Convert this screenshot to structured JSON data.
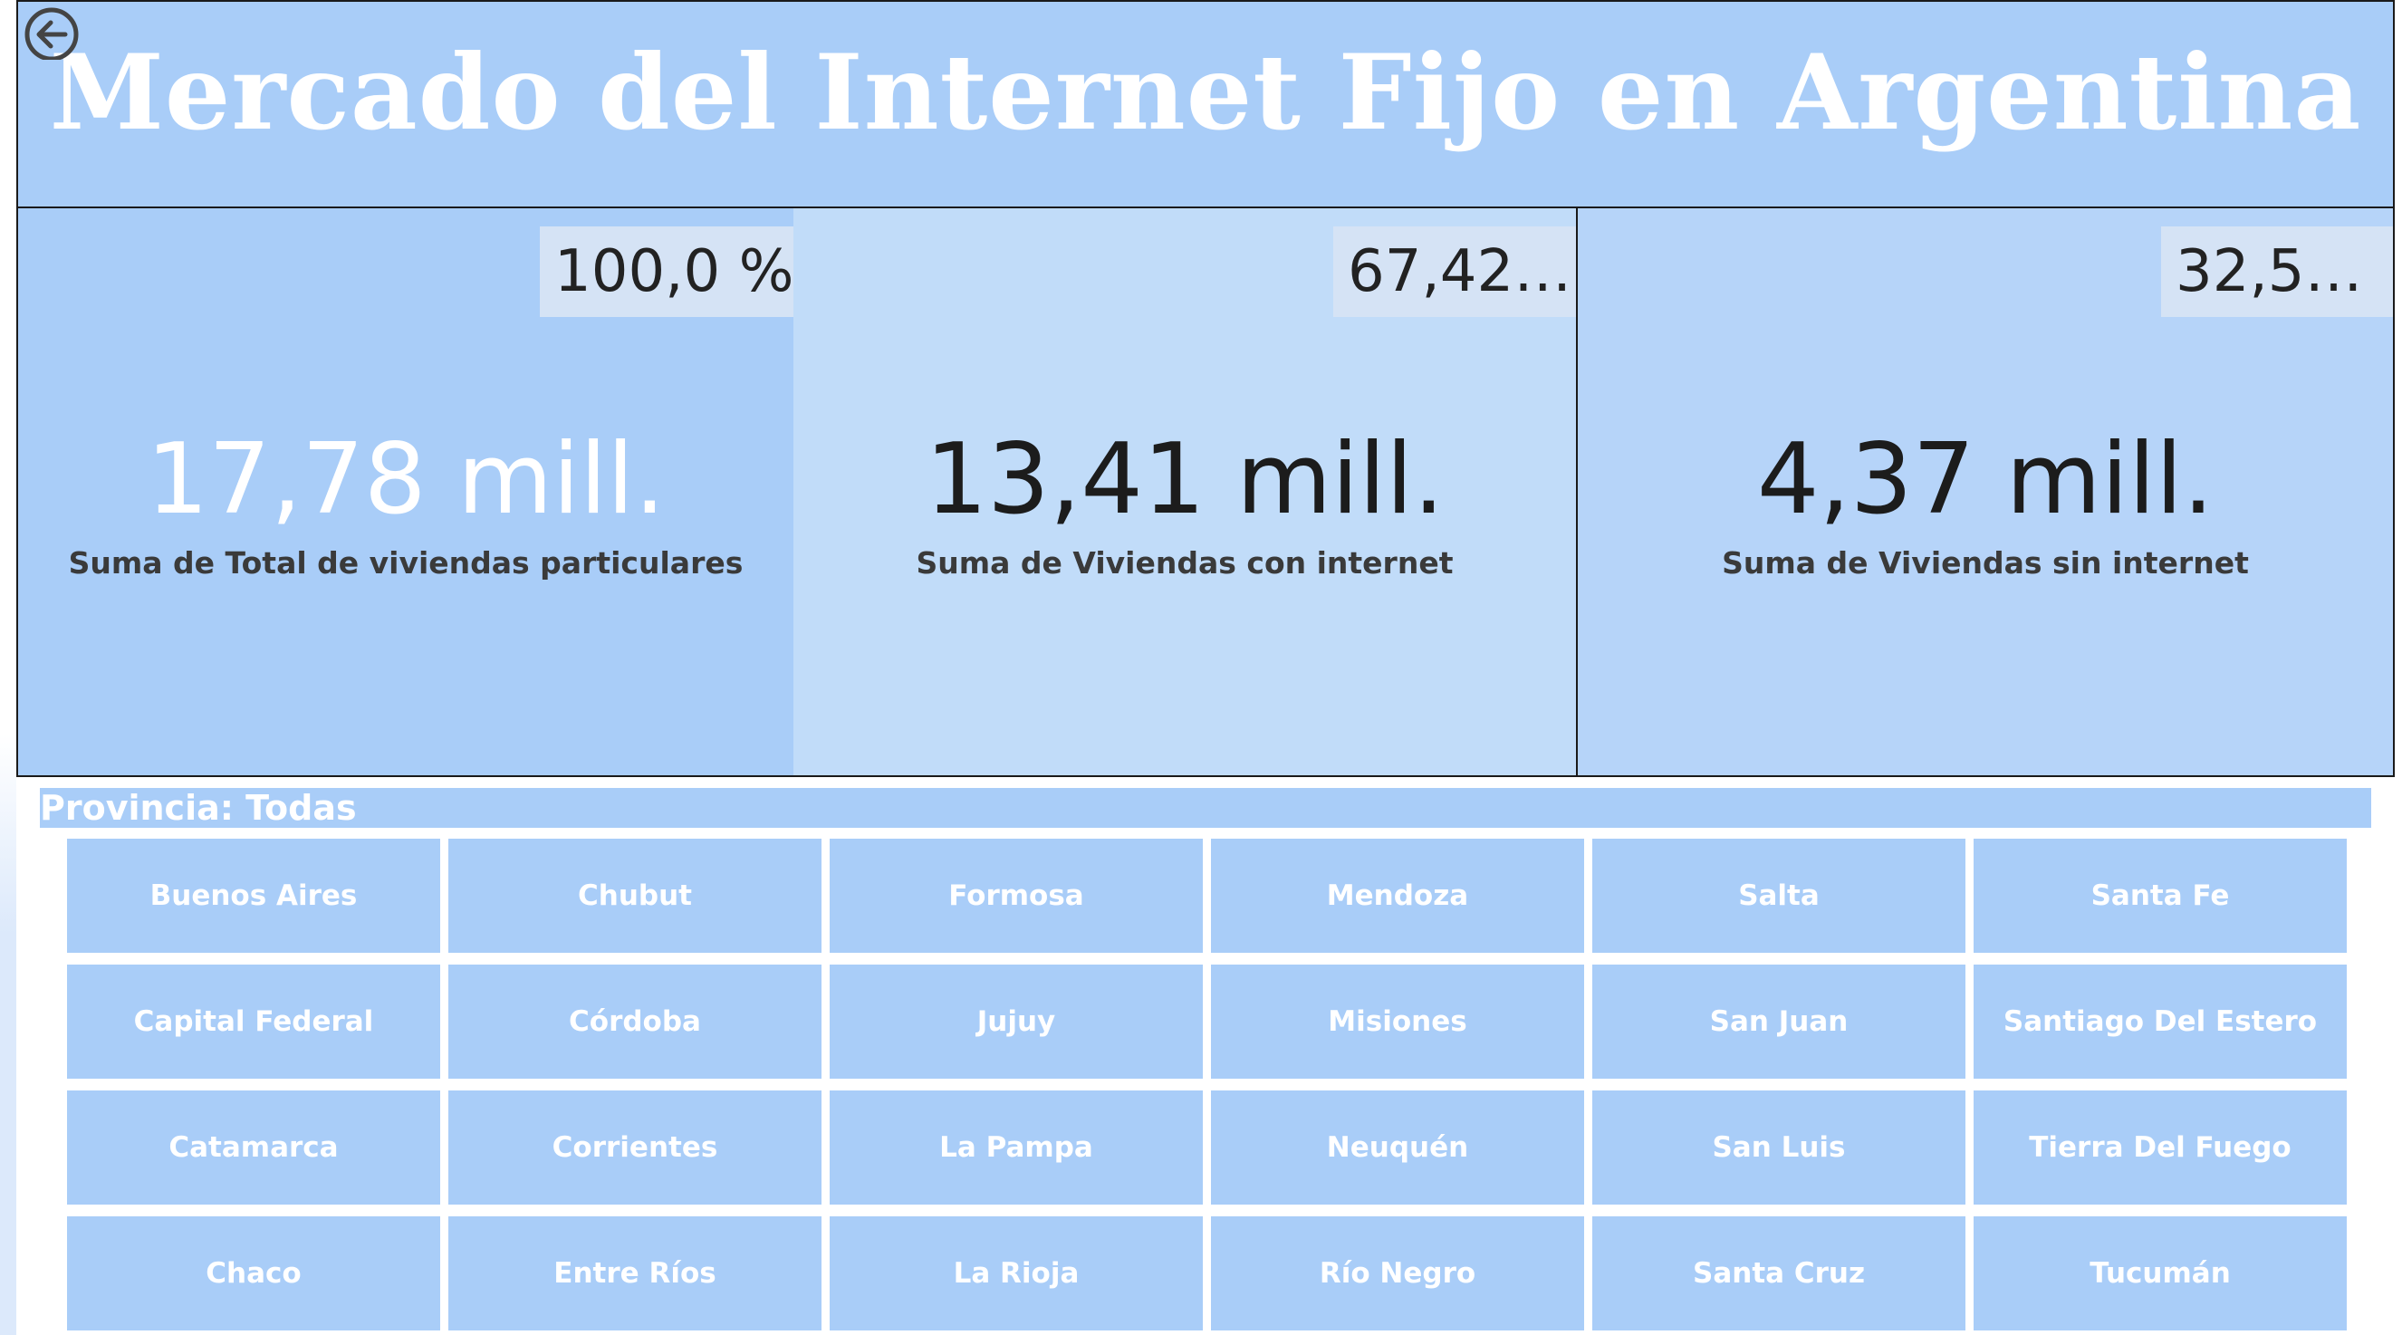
{
  "header": {
    "title": "Mercado del Internet Fijo en Argentina",
    "back_icon": "arrow-left-circle-icon"
  },
  "cards": [
    {
      "percent": "100,0 %",
      "value": "17,78 mill.",
      "caption": "Suma de Total de viviendas particulares"
    },
    {
      "percent": "67,42…",
      "value": "13,41 mill.",
      "caption": "Suma de Viviendas con internet"
    },
    {
      "percent": "32,5…",
      "value": "4,37 mill.",
      "caption": "Suma de Viviendas sin internet"
    }
  ],
  "slicer": {
    "title": "Provincia: Todas",
    "options": [
      "Buenos Aires",
      "Chubut",
      "Formosa",
      "Mendoza",
      "Salta",
      "Santa Fe",
      "Capital Federal",
      "Córdoba",
      "Jujuy",
      "Misiones",
      "San Juan",
      "Santiago Del Estero",
      "Catamarca",
      "Corrientes",
      "La Pampa",
      "Neuquén",
      "San Luis",
      "Tierra Del Fuego",
      "Chaco",
      "Entre Ríos",
      "La Rioja",
      "Río Negro",
      "Santa Cruz",
      "Tucumán"
    ]
  },
  "colors": {
    "accent": "#a9cdf8",
    "card2": "#c1dcf9",
    "card3": "#b6d4f9",
    "badge": "#d5e3f5"
  }
}
